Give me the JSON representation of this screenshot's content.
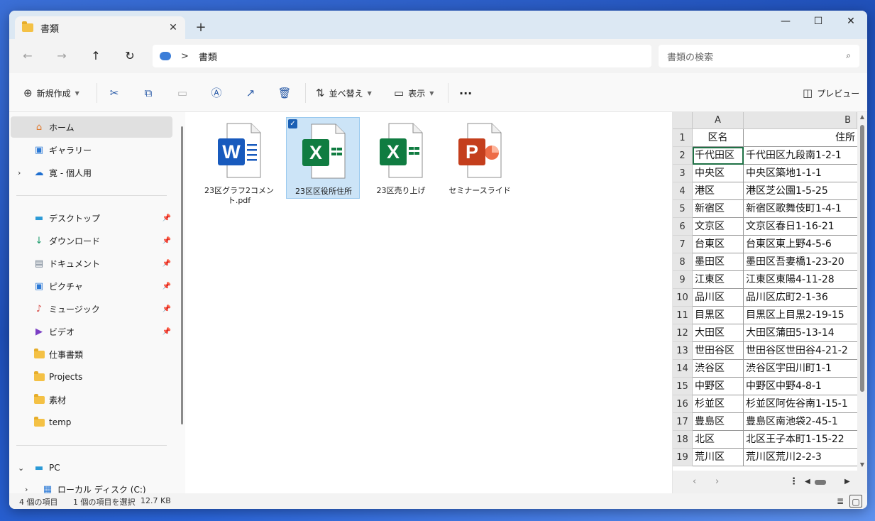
{
  "window": {
    "tab_title": "書類",
    "new_tab": "+",
    "min": "—",
    "max": "☐",
    "close": "✕",
    "tab_close": "✕"
  },
  "address": {
    "back": "←",
    "forward": "→",
    "up": "↑",
    "refresh": "↻",
    "separator": ">",
    "crumb": "書類",
    "search_placeholder": "書類の検索",
    "search_icon": "⌕"
  },
  "commands": {
    "new_label": "新規作成",
    "sort_label": "並べ替え",
    "view_label": "表示",
    "more": "···",
    "preview_label": "プレビュー"
  },
  "sidebar": {
    "items": [
      {
        "label": "ホーム",
        "icon": "home-icon"
      },
      {
        "label": "ギャラリー",
        "icon": "gallery-icon"
      },
      {
        "label": "寛 - 個人用",
        "icon": "onedrive-icon"
      },
      {
        "label": "デスクトップ",
        "icon": "desktop-icon"
      },
      {
        "label": "ダウンロード",
        "icon": "download-icon"
      },
      {
        "label": "ドキュメント",
        "icon": "document-icon"
      },
      {
        "label": "ピクチャ",
        "icon": "pictures-icon"
      },
      {
        "label": "ミュージック",
        "icon": "music-icon"
      },
      {
        "label": "ビデオ",
        "icon": "video-icon"
      },
      {
        "label": "仕事書類",
        "icon": "folder-icon"
      },
      {
        "label": "Projects",
        "icon": "folder-icon"
      },
      {
        "label": "素材",
        "icon": "folder-icon"
      },
      {
        "label": "temp",
        "icon": "folder-icon"
      },
      {
        "label": "PC",
        "icon": "pc-icon"
      },
      {
        "label": "ローカル ディスク (C:)",
        "icon": "drive-icon"
      }
    ]
  },
  "files": [
    {
      "name": "23区グラフ2コメント.pdf",
      "type": "word",
      "letter": "W",
      "color": "#185abd"
    },
    {
      "name": "23区区役所住所",
      "type": "excel",
      "letter": "X",
      "color": "#107c41",
      "selected": true
    },
    {
      "name": "23区売り上げ",
      "type": "excel",
      "letter": "X",
      "color": "#107c41"
    },
    {
      "name": "セミナースライド",
      "type": "powerpoint",
      "letter": "P",
      "color": "#c43e1c"
    }
  ],
  "preview": {
    "col_a": "A",
    "col_b": "B",
    "header_a": "区名",
    "header_b": "住所",
    "rows": [
      [
        "千代田区",
        "千代田区九段南1-2-1"
      ],
      [
        "中央区",
        "中央区築地1-1-1"
      ],
      [
        "港区",
        "港区芝公園1-5-25"
      ],
      [
        "新宿区",
        "新宿区歌舞伎町1-4-1"
      ],
      [
        "文京区",
        "文京区春日1-16-21"
      ],
      [
        "台東区",
        "台東区東上野4-5-6"
      ],
      [
        "墨田区",
        "墨田区吾妻橋1-23-20"
      ],
      [
        "江東区",
        "江東区東陽4-11-28"
      ],
      [
        "品川区",
        "品川区広町2-1-36"
      ],
      [
        "目黒区",
        "目黒区上目黒2-19-15"
      ],
      [
        "大田区",
        "大田区蒲田5-13-14"
      ],
      [
        "世田谷区",
        "世田谷区世田谷4-21-2"
      ],
      [
        "渋谷区",
        "渋谷区宇田川町1-1"
      ],
      [
        "中野区",
        "中野区中野4-8-1"
      ],
      [
        "杉並区",
        "杉並区阿佐谷南1-15-1"
      ],
      [
        "豊島区",
        "豊島区南池袋2-45-1"
      ],
      [
        "北区",
        "北区王子本町1-15-22"
      ],
      [
        "荒川区",
        "荒川区荒川2-2-3"
      ]
    ],
    "row_numbers": [
      "1",
      "2",
      "3",
      "4",
      "5",
      "6",
      "7",
      "8",
      "9",
      "10",
      "11",
      "12",
      "13",
      "14",
      "15",
      "16",
      "17",
      "18",
      "19"
    ]
  },
  "status": {
    "count": "4 個の項目",
    "selection": "1 個の項目を選択",
    "size": "12.7 KB"
  },
  "colors": {
    "accent": "#1a5fb4",
    "excel": "#107c41",
    "word": "#185abd",
    "powerpoint": "#c43e1c"
  }
}
